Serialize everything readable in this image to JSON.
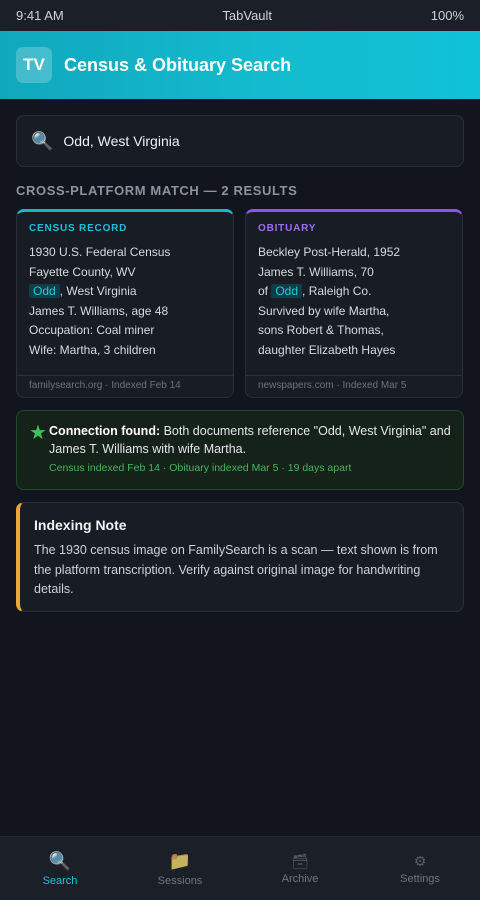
{
  "status_bar": {
    "time": "9:41 AM",
    "app": "TabVault",
    "battery": "100%"
  },
  "header": {
    "logo": "TV",
    "title": "Census & Obituary Search"
  },
  "search": {
    "icon": "search-icon",
    "value": "Odd, West Virginia"
  },
  "results_heading": "CROSS-PLATFORM MATCH — 2 RESULTS",
  "census": {
    "label": "CENSUS RECORD",
    "accent": "#17b7cc",
    "lines": [
      "1930 U.S. Federal Census",
      "Fayette County, WV"
    ],
    "highlight": "Odd",
    "highlight_suffix": ", West Virginia",
    "lines_after": [
      "James T. Williams, age 48",
      "Occupation: Coal miner",
      "Wife: Martha, 3 children"
    ],
    "footer": "familysearch.org · Indexed Feb 14"
  },
  "obituary": {
    "label": "OBITUARY",
    "accent": "#8a55e8",
    "lines": [
      "Beckley Post-Herald, 1952",
      "James T. Williams, 70"
    ],
    "highlight_prefix": "of ",
    "highlight": "Odd",
    "highlight_suffix": ", Raleigh Co.",
    "lines_after": [
      "Survived by wife Martha,",
      "sons Robert & Thomas,",
      "daughter Elizabeth Hayes"
    ],
    "footer": "newspapers.com · Indexed Mar 5"
  },
  "connection": {
    "icon": "star-icon",
    "title": "Connection found:",
    "text": " Both documents reference \"Odd, West Virginia\" and James T. Williams with wife Martha.",
    "sub": "Census indexed Feb 14 · Obituary indexed Mar 5 · 19 days apart"
  },
  "note": {
    "title": "Indexing Note",
    "body": "The 1930 census image on FamilySearch is a scan — text shown is from the platform transcription. Verify against original image for handwriting details.",
    "accent": "#f0a73a"
  },
  "tabs": [
    {
      "label": "Search",
      "icon": "search-icon",
      "active": true
    },
    {
      "label": "Sessions",
      "icon": "folder-icon",
      "active": false
    },
    {
      "label": "Archive",
      "icon": "archive-icon",
      "active": false
    },
    {
      "label": "Settings",
      "icon": "gear-icon",
      "active": false
    }
  ]
}
